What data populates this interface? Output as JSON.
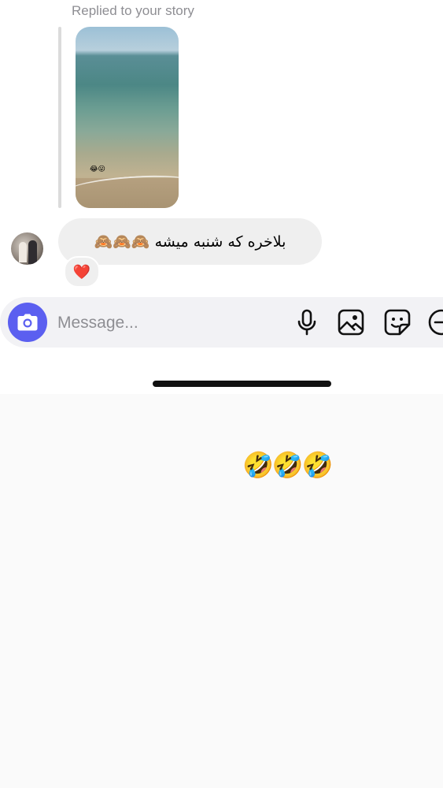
{
  "thread": {
    "reply_label": "Replied to your story",
    "story_emoji": "😂😛",
    "message_text": "بلاخره که شنبه میشه 🙈🙈🙈",
    "reaction": "❤️"
  },
  "composer": {
    "placeholder": "Message...",
    "accent_color": "#5b5ff0"
  },
  "overlay": {
    "caption_emoji": "🤣🤣🤣"
  }
}
